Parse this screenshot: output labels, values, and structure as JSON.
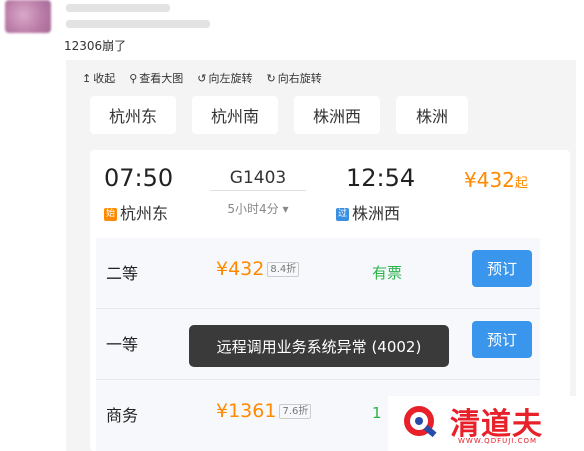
{
  "post": {
    "text": "12306崩了"
  },
  "toolbar": {
    "items": [
      {
        "icon": "↥",
        "label": "收起"
      },
      {
        "icon": "⚲",
        "label": "查看大图"
      },
      {
        "icon": "↺",
        "label": "向左旋转"
      },
      {
        "icon": "↻",
        "label": "向右旋转"
      }
    ]
  },
  "stations": [
    "杭州东",
    "杭州南",
    "株洲西",
    "株洲"
  ],
  "train": {
    "dep_time": "07:50",
    "arr_time": "12:54",
    "number": "G1403",
    "duration": "5小时4分",
    "price_from": "¥432",
    "price_from_suffix": "起",
    "dep_badge": "始",
    "dep_station": "杭州东",
    "arr_badge": "过",
    "arr_station": "株洲西"
  },
  "seats": [
    {
      "class": "二等",
      "price": "¥432",
      "discount": "8.4折",
      "availability": "有票",
      "book": "预订"
    },
    {
      "class": "一等",
      "price": "",
      "discount": "",
      "availability": "",
      "book": "预订"
    },
    {
      "class": "商务",
      "price": "¥1361",
      "discount": "7.6折",
      "availability": "1",
      "book": ""
    }
  ],
  "toast": "远程调用业务系统异常 (4002)",
  "watermark": {
    "text": "清道夫",
    "url": "WWW.QDFUJI.COM"
  },
  "colors": {
    "orange": "#ff8a00",
    "green": "#2bb24c",
    "blue": "#3a95ec",
    "red": "#e8202a"
  }
}
